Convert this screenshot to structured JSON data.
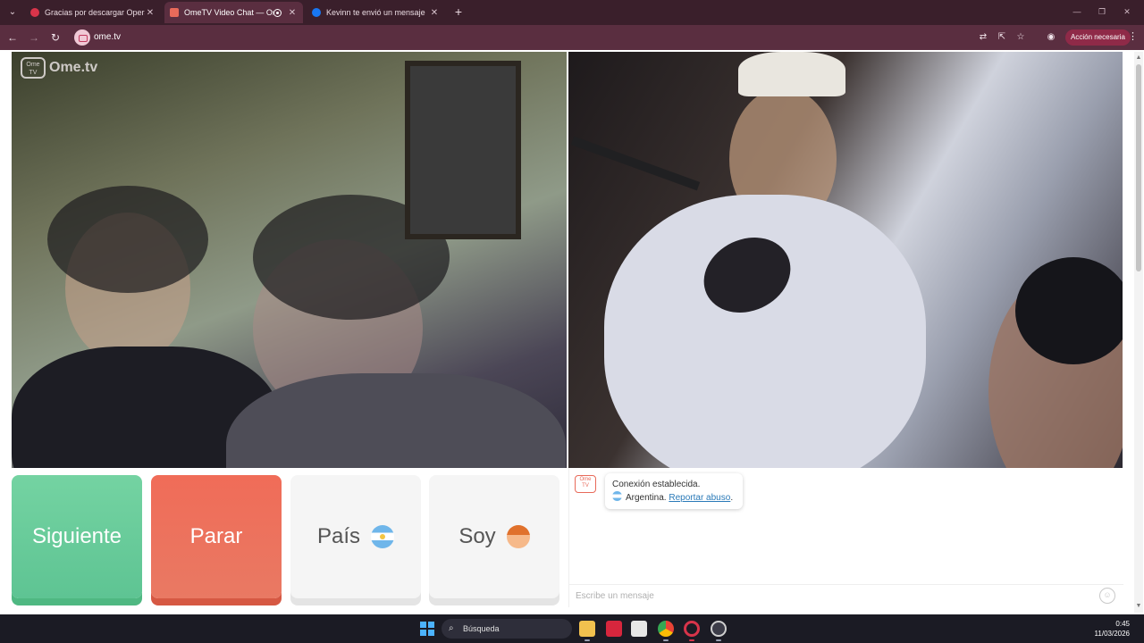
{
  "browser": {
    "tabs": [
      {
        "title": "Gracias por descargar Opera",
        "active": false
      },
      {
        "title": "OmeTV Video Chat — Ome",
        "active": true
      },
      {
        "title": "Kevinn te envió un mensaje",
        "active": false
      }
    ],
    "url": "ome.tv",
    "action_button": "Acción necesaria",
    "colors": {
      "tabbar": "#3a1f2b",
      "toolbar": "#5a2e40",
      "action": "#8f2a48"
    }
  },
  "page": {
    "logo_text": "Ome.tv",
    "logo_badge": "Ome TV",
    "controls": {
      "next_label": "Siguiente",
      "stop_label": "Parar",
      "country_label": "País",
      "gender_label": "Soy"
    },
    "chat": {
      "system_line1": "Conexión establecida.",
      "country_name": "Argentina.",
      "report_link": "Reportar abuso",
      "report_suffix": ".",
      "input_placeholder": "Escribe un mensaje",
      "chat_logo_badge": "Ome TV"
    }
  },
  "taskbar": {
    "search_label": "Búsqueda",
    "time": "0:45",
    "date": "11/03/2026"
  }
}
